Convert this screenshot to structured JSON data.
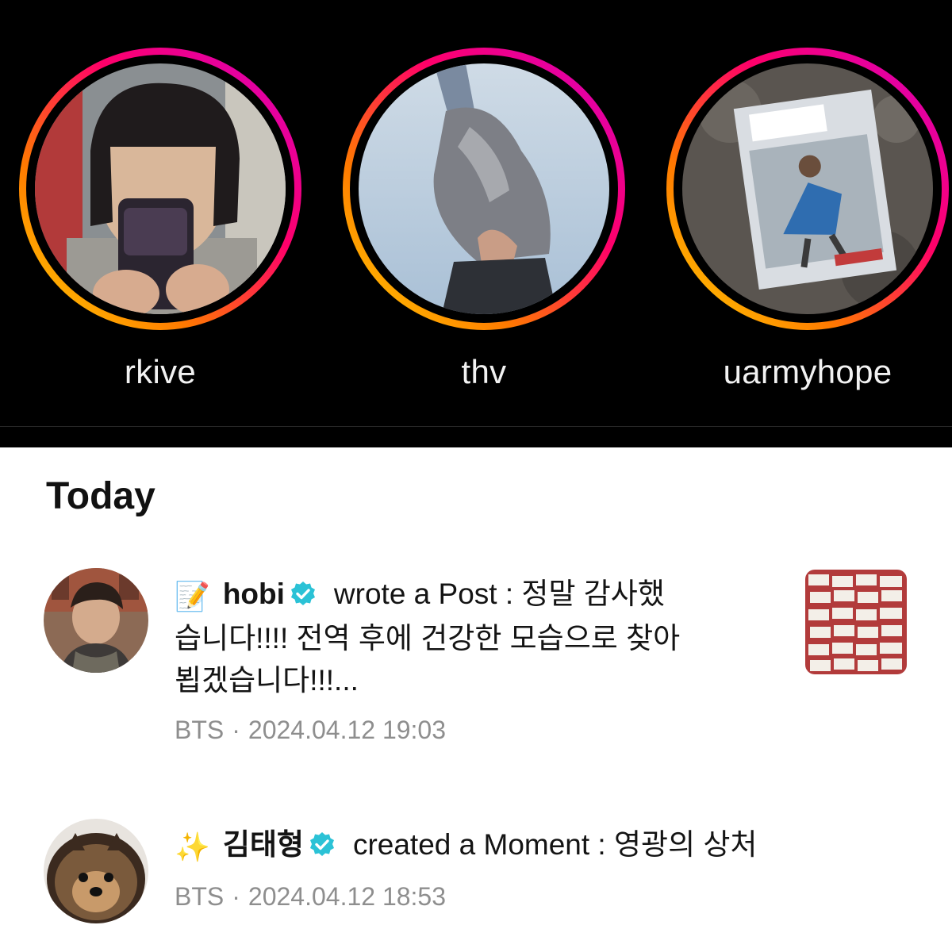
{
  "stories": [
    {
      "username": "rkive"
    },
    {
      "username": "thv"
    },
    {
      "username": "uarmyhope"
    }
  ],
  "section": {
    "title": "Today"
  },
  "activity": [
    {
      "emoji": "📝",
      "author": "hobi",
      "verified": true,
      "lines": [
        "wrote a Post : 정말 감사했",
        "습니다!!!! 전역 후에 건강한 모습으로 찾아",
        "뵙겠습니다!!!..."
      ],
      "group": "BTS",
      "separator": "·",
      "datetime": "2024.04.12 19:03",
      "has_thumbnail": true
    },
    {
      "emoji": "✨",
      "author": "김태형",
      "verified": true,
      "lines": [
        "created a Moment : 영광의 상처"
      ],
      "group": "BTS",
      "separator": "·",
      "datetime": "2024.04.12 18:53",
      "has_thumbnail": false
    }
  ],
  "colors": {
    "ring_gradient": [
      "#ffd600",
      "#ff7a00",
      "#ff0069",
      "#d300c5"
    ],
    "verified_badge": "#2bc2d6",
    "meta_text": "#8e8e8e"
  }
}
